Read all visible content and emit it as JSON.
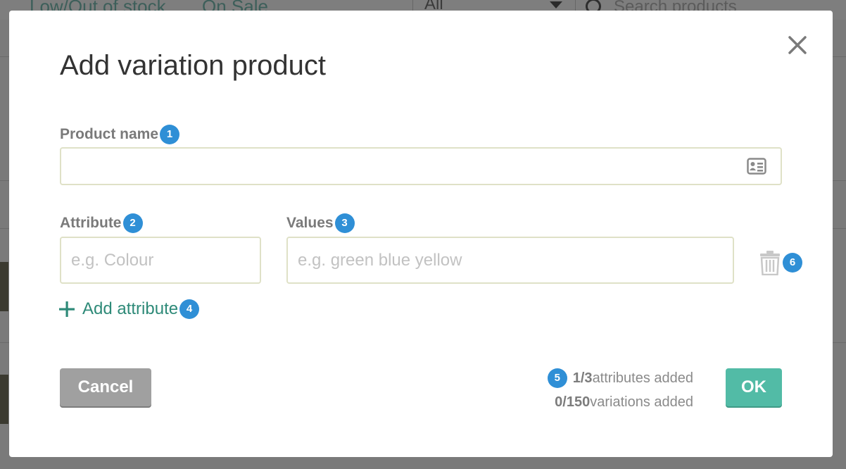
{
  "background": {
    "filters": [
      "Low/Out of stock",
      "On Sale"
    ],
    "select_value": "All",
    "search_placeholder": "Search products"
  },
  "modal": {
    "title": "Add variation product",
    "close_icon": "close-icon",
    "product_name": {
      "label": "Product name",
      "badge": "1",
      "value": "",
      "placeholder": "",
      "icon": "contact-card-icon"
    },
    "attribute": {
      "label": "Attribute",
      "badge": "2",
      "value": "",
      "placeholder": "e.g. Colour"
    },
    "values": {
      "label": "Values",
      "badge": "3",
      "value": "",
      "placeholder": "e.g. green blue yellow"
    },
    "delete": {
      "icon": "trash-icon",
      "badge": "6"
    },
    "add_attribute": {
      "label": "Add attribute",
      "badge": "4",
      "icon": "plus-icon"
    },
    "cancel_label": "Cancel",
    "ok_label": "OK",
    "status": {
      "badge": "5",
      "attributes_count": "1/3",
      "attributes_text": "attributes added",
      "variations_count": "0/150",
      "variations_text": "variations added"
    }
  },
  "colors": {
    "accent_green": "#52bba6",
    "link_green": "#2e8a78",
    "badge_blue": "#2f8fd6",
    "cancel_gray": "#a0a0a0"
  }
}
